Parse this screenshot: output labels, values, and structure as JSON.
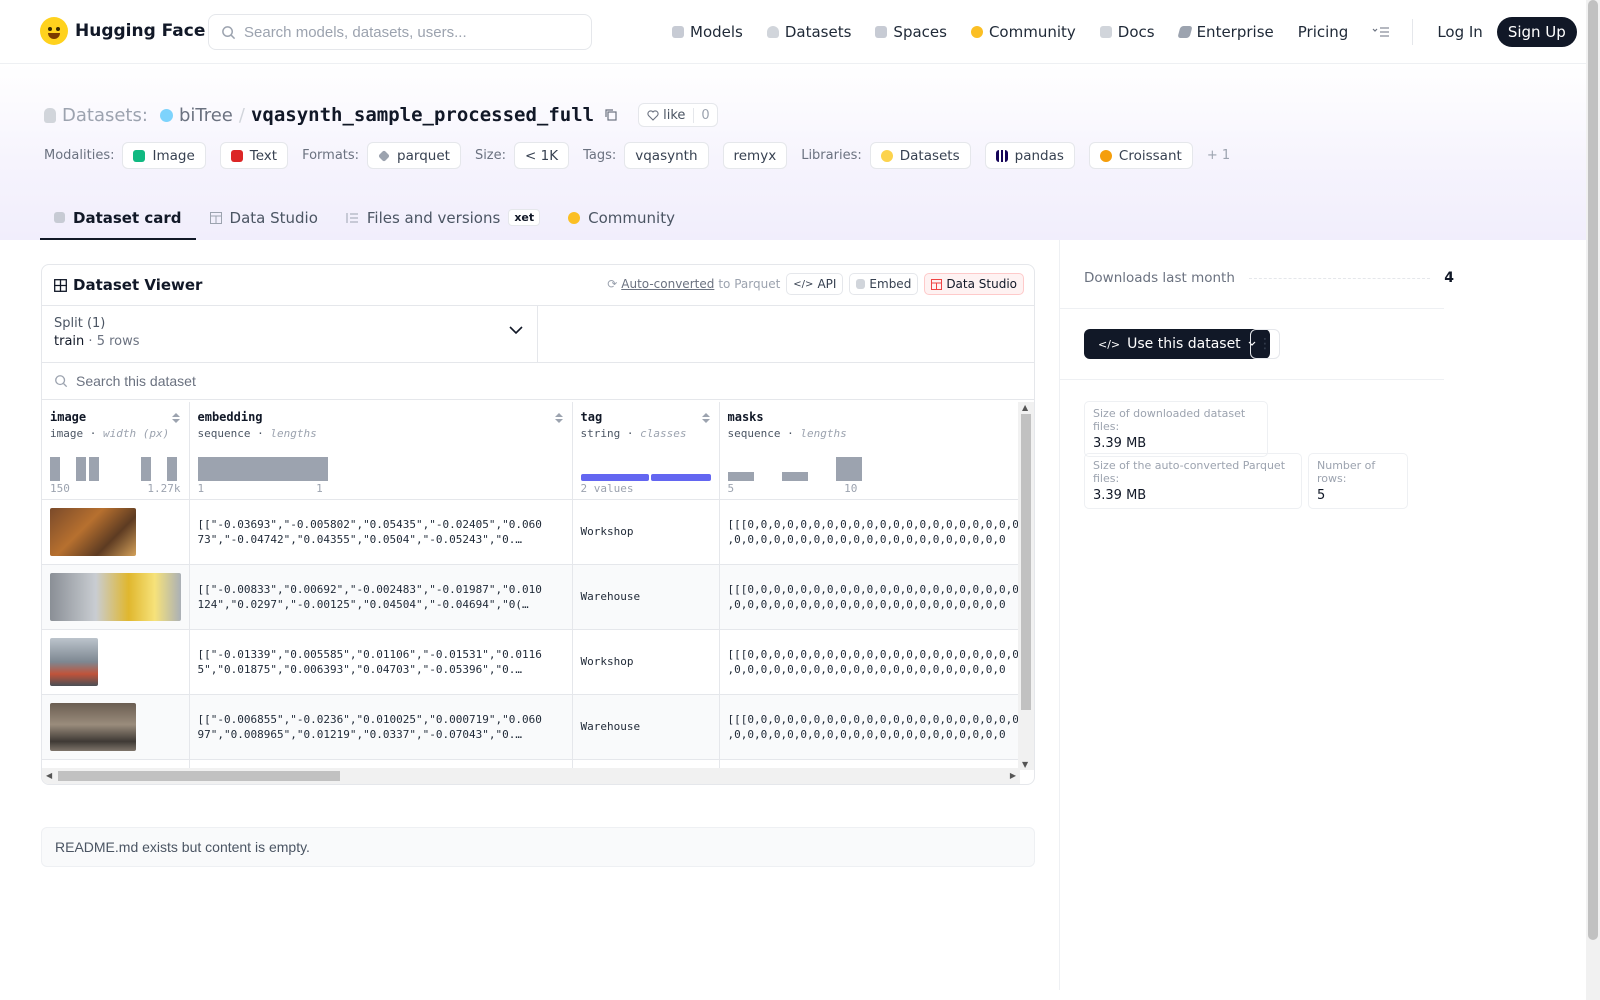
{
  "nav": {
    "brand": "Hugging Face",
    "search_placeholder": "Search models, datasets, users...",
    "links": [
      "Models",
      "Datasets",
      "Spaces",
      "Community",
      "Docs",
      "Enterprise",
      "Pricing"
    ],
    "login": "Log In",
    "signup": "Sign Up"
  },
  "repo": {
    "type_label": "Datasets:",
    "owner": "biTree",
    "slash": "/",
    "name": "vqasynth_sample_processed_full",
    "like_label": "like",
    "like_count": "0"
  },
  "tags": {
    "modalities_label": "Modalities:",
    "modalities": [
      "Image",
      "Text"
    ],
    "formats_label": "Formats:",
    "formats": [
      "parquet"
    ],
    "size_label": "Size:",
    "size": "< 1K",
    "tags_label": "Tags:",
    "tags": [
      "vqasynth",
      "remyx"
    ],
    "libraries_label": "Libraries:",
    "libraries": [
      "Datasets",
      "pandas",
      "Croissant"
    ],
    "more": "+ 1"
  },
  "tabs": [
    "Dataset card",
    "Data Studio",
    "Files and versions",
    "Community"
  ],
  "xet_badge": "xet",
  "viewer": {
    "title": "Dataset Viewer",
    "auto_link": "Auto-converted",
    "auto_rest": "to Parquet",
    "api": "API",
    "embed": "Embed",
    "studio": "Data Studio",
    "split_label": "Split (1)",
    "split_value": "train",
    "split_dot": "·",
    "split_rows": "5 rows",
    "search_placeholder": "Search this dataset",
    "columns": [
      {
        "name": "image",
        "type": "image",
        "sub": "width (px)",
        "min": "150",
        "max": "1.27k"
      },
      {
        "name": "embedding",
        "type": "sequence",
        "sub": "lengths",
        "min": "1",
        "max": "1"
      },
      {
        "name": "tag",
        "type": "string",
        "sub": "classes",
        "min": "2 values",
        "max": ""
      },
      {
        "name": "masks",
        "type": "sequence",
        "sub": "lengths",
        "min": "5",
        "max": "10"
      }
    ],
    "rows": [
      {
        "embedding": "[[\"-0.03693\",\"-0.005802\",\"0.05435\",\"-0.02405\",\"0.060\n73\",\"-0.04742\",\"0.04355\",\"0.0504\",\"-0.05243\",\"0.…",
        "tag": "Workshop",
        "masks": "[[[0,0,0,0,0,0,0,0,0,0,0,0,0,0,0,0,0,0,0,0,0\n,0,0,0,0,0,0,0,0,0,0,0,0,0,0,0,0,0,0,0,0,0"
      },
      {
        "embedding": "[[\"-0.00833\",\"0.00692\",\"-0.002483\",\"-0.01987\",\"0.010\n124\",\"0.0297\",\"-0.00125\",\"0.04504\",\"-0.04694\",\"0(…",
        "tag": "Warehouse",
        "masks": "[[[0,0,0,0,0,0,0,0,0,0,0,0,0,0,0,0,0,0,0,0,0\n,0,0,0,0,0,0,0,0,0,0,0,0,0,0,0,0,0,0,0,0,0"
      },
      {
        "embedding": "[[\"-0.01339\",\"0.005585\",\"0.01106\",\"-0.01531\",\"0.0116\n5\",\"0.01875\",\"0.006393\",\"0.04703\",\"-0.05396\",\"0.…",
        "tag": "Workshop",
        "masks": "[[[0,0,0,0,0,0,0,0,0,0,0,0,0,0,0,0,0,0,0,0,0\n,0,0,0,0,0,0,0,0,0,0,0,0,0,0,0,0,0,0,0,0,0"
      },
      {
        "embedding": "[[\"-0.006855\",\"-0.0236\",\"0.010025\",\"0.000719\",\"0.060\n97\",\"0.008965\",\"0.01219\",\"0.0337\",\"-0.07043\",\"0.…",
        "tag": "Warehouse",
        "masks": "[[[0,0,0,0,0,0,0,0,0,0,0,0,0,0,0,0,0,0,0,0,0\n,0,0,0,0,0,0,0,0,0,0,0,0,0,0,0,0,0,0,0,0,0"
      }
    ]
  },
  "readme_text": "README.md exists but content is empty.",
  "sidebar": {
    "downloads_label": "Downloads last month",
    "downloads_value": "4",
    "use_button": "Use this dataset",
    "size_downloaded_label": "Size of downloaded dataset files:",
    "size_downloaded_value": "3.39 MB",
    "size_parquet_label": "Size of the auto-converted Parquet files:",
    "size_parquet_value": "3.39 MB",
    "num_rows_label": "Number of rows:",
    "num_rows_value": "5"
  },
  "colors": {
    "accent": "#6366f1",
    "dark": "#111827",
    "studio_red": "#ef4444"
  }
}
